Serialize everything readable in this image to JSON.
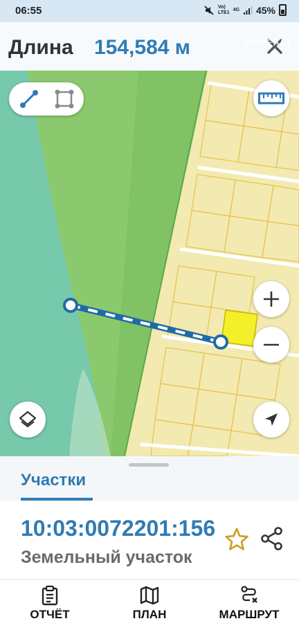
{
  "status_bar": {
    "time": "06:55",
    "net_top": "Vo)",
    "net_bottom": "LTE1",
    "network_type": "4G",
    "battery_percent": "45%",
    "watermark": "ONREALT",
    "watermark_sub": "НЕДВИЖИМОСТЬ",
    "icons": [
      "mute-icon",
      "signal-icon",
      "battery-icon"
    ]
  },
  "header": {
    "label": "Длина",
    "value": "154,584 м",
    "close_icon": "close-icon"
  },
  "map": {
    "measure_modes": [
      "line-measure-icon",
      "polygon-measure-icon"
    ],
    "active_mode": "line",
    "controls": [
      "ruler-icon",
      "zoom-in-icon",
      "zoom-out-icon",
      "layers-icon",
      "locate-icon"
    ],
    "colors": {
      "water": "#77c9ab",
      "forest": "#80c264",
      "lightgreen": "#a3d88a",
      "plots": "#f2eab0",
      "plot_lines": "#e9c24f",
      "road": "#ffffff",
      "selected_plot": "#f3f02a",
      "measure_line": "#1f6ba7"
    }
  },
  "sheet": {
    "tab_label": "Участки",
    "parcel_id": "10:03:0072201:156",
    "parcel_type": "Земельный участок",
    "favorite_icon": "star-icon",
    "share_icon": "share-icon"
  },
  "nav": {
    "report_label": "ОТЧЁТ",
    "plan_label": "ПЛАН",
    "route_label": "МАРШРУТ"
  }
}
